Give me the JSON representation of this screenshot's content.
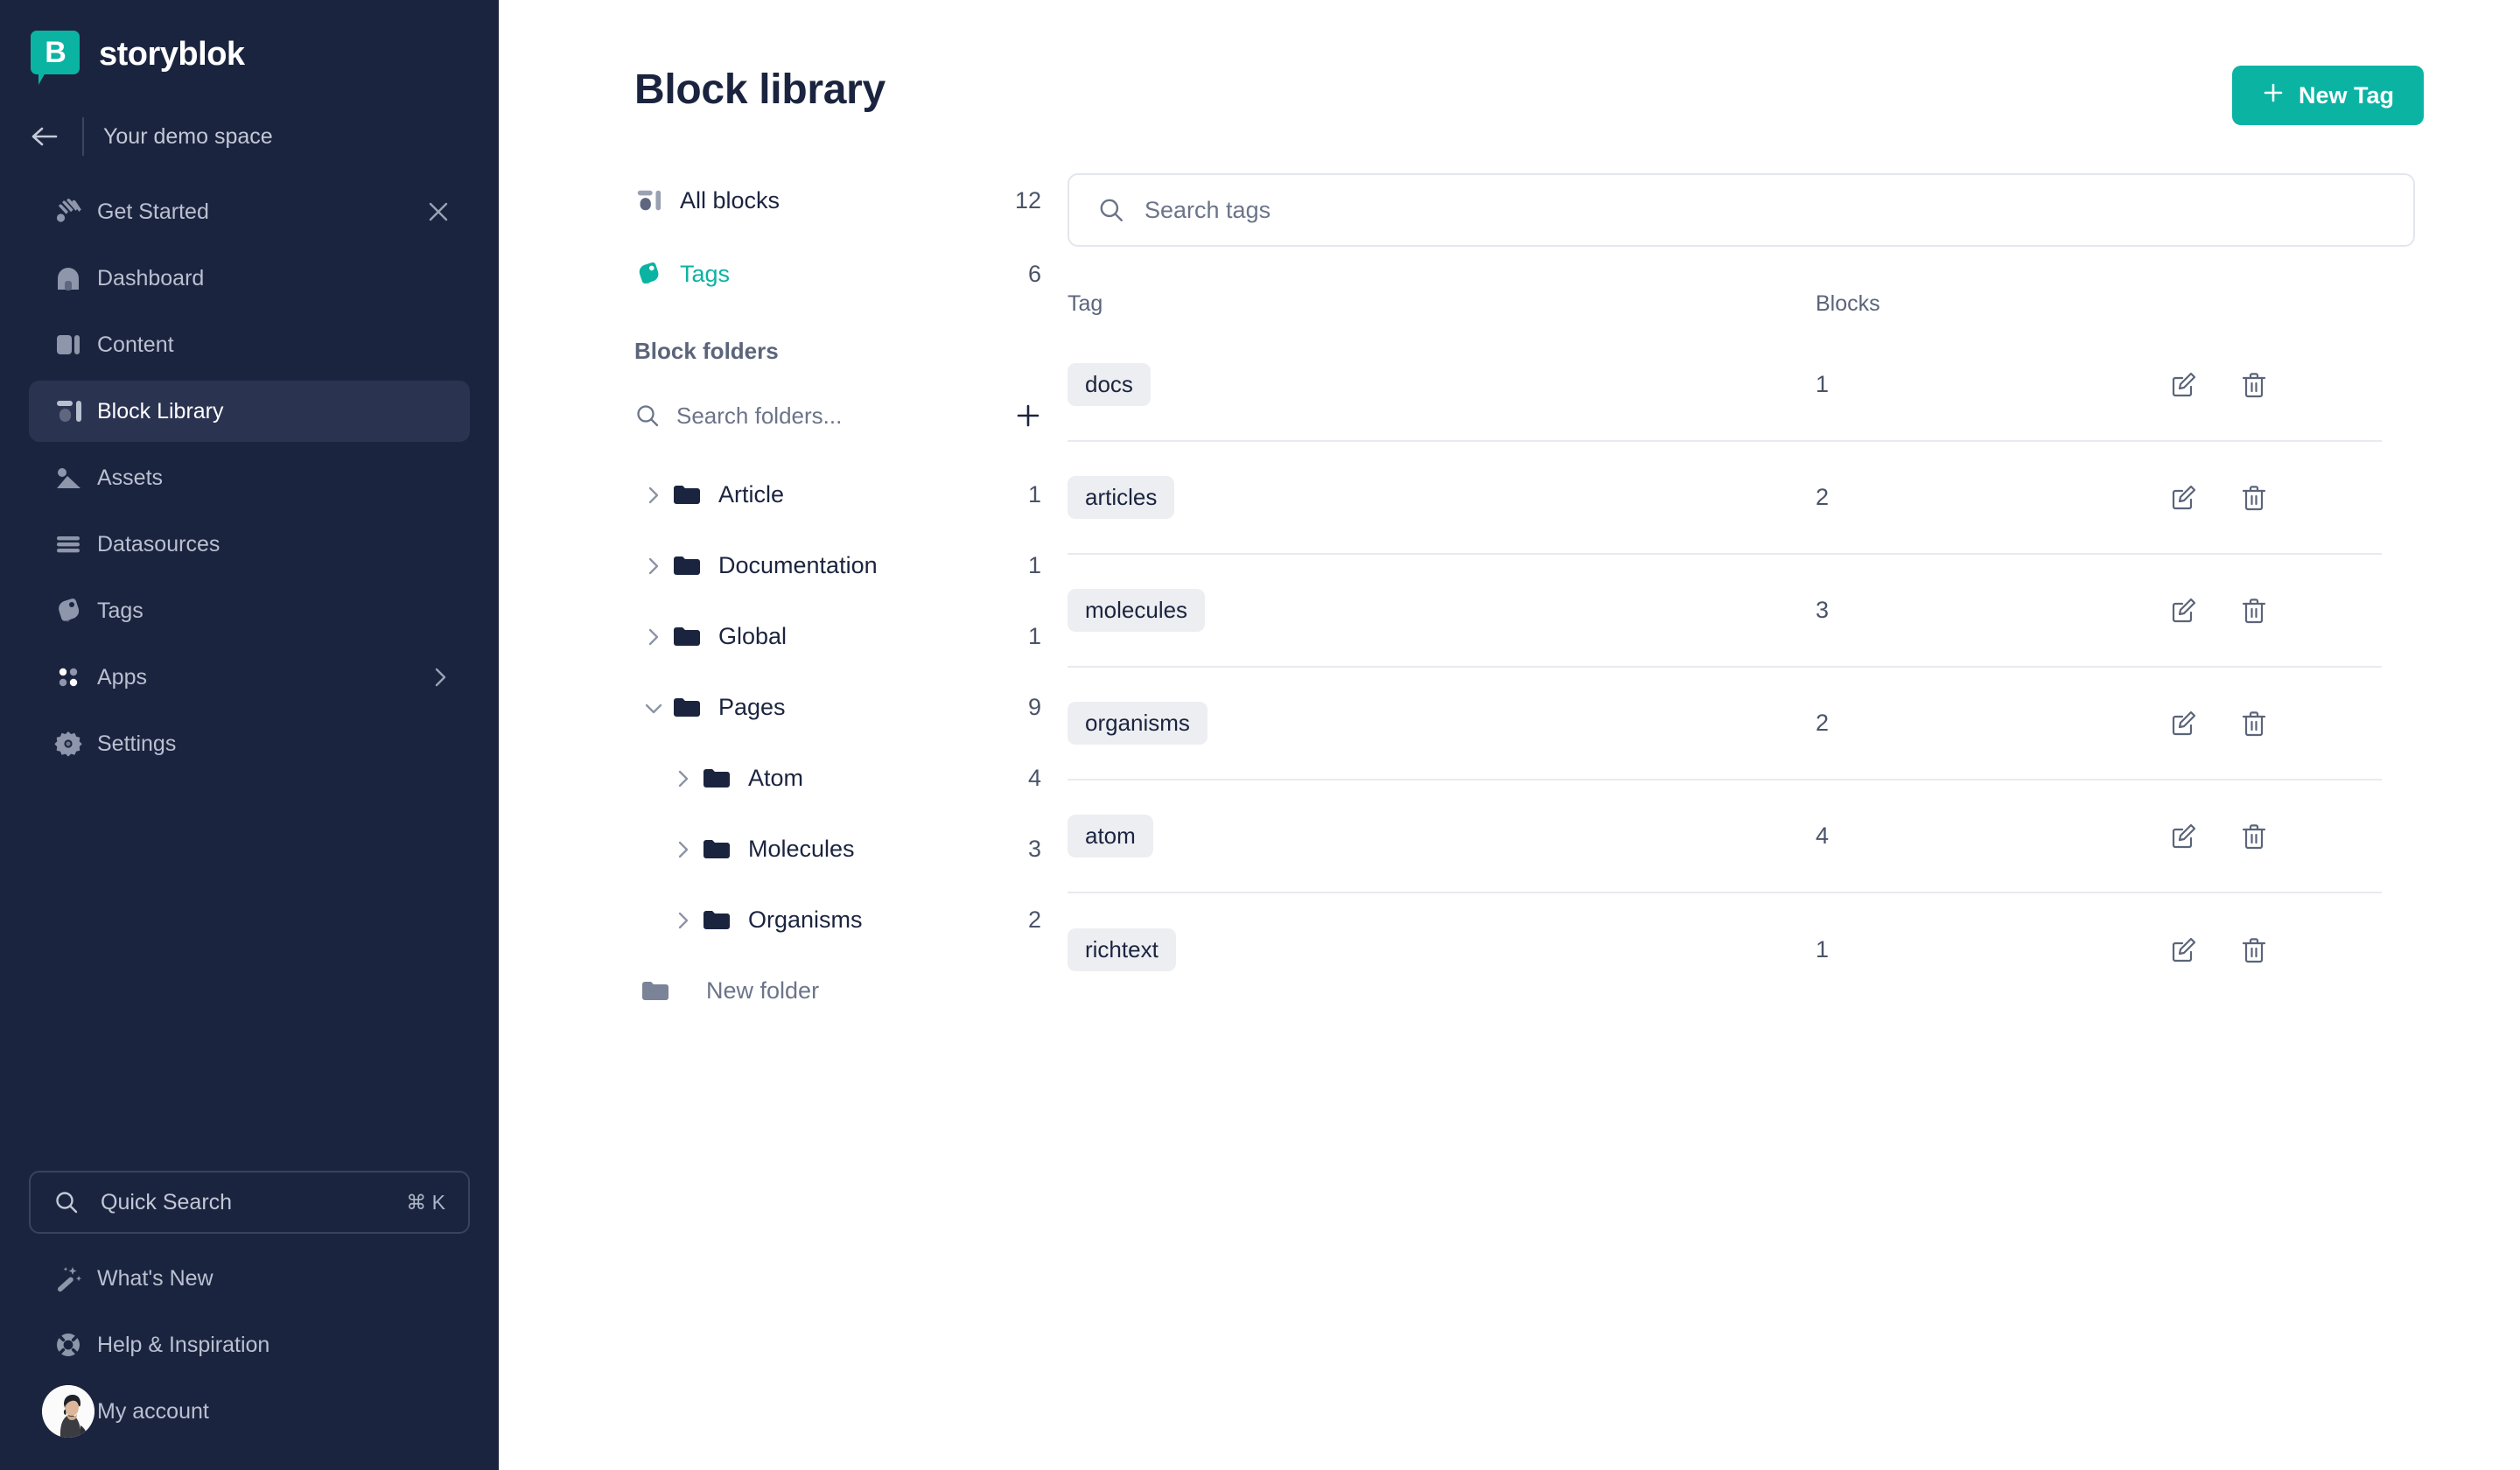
{
  "brand": {
    "name": "storyblok",
    "logo_letter": "B",
    "accent_color": "#0bb3a3",
    "sidebar_color": "#1b243f"
  },
  "sidebar": {
    "space": {
      "label": "Your demo space",
      "back_icon": "arrow-left-icon"
    },
    "items": [
      {
        "label": "Get Started",
        "icon": "waving-hand-icon",
        "trailing": "close-icon",
        "active": false
      },
      {
        "label": "Dashboard",
        "icon": "dashboard-icon",
        "trailing": "",
        "active": false
      },
      {
        "label": "Content",
        "icon": "content-icon",
        "trailing": "",
        "active": false
      },
      {
        "label": "Block Library",
        "icon": "blocks-icon",
        "trailing": "",
        "active": true
      },
      {
        "label": "Assets",
        "icon": "image-icon",
        "trailing": "",
        "active": false
      },
      {
        "label": "Datasources",
        "icon": "lines-icon",
        "trailing": "",
        "active": false
      },
      {
        "label": "Tags",
        "icon": "tag-icon",
        "trailing": "",
        "active": false
      },
      {
        "label": "Apps",
        "icon": "apps-grid-icon",
        "trailing": "chevron-right-icon",
        "active": false
      },
      {
        "label": "Settings",
        "icon": "gear-icon",
        "trailing": "",
        "active": false
      }
    ],
    "quick_search": {
      "label": "Quick Search",
      "shortcut": "⌘ K",
      "icon": "search-icon"
    },
    "bottom_items": [
      {
        "label": "What's New",
        "icon": "magic-wand-icon"
      },
      {
        "label": "Help & Inspiration",
        "icon": "lifebuoy-icon"
      }
    ],
    "account": {
      "label": "My account",
      "icon": "avatar"
    }
  },
  "header": {
    "title": "Block library",
    "new_tag_button": {
      "label": "New Tag",
      "icon": "plus-icon"
    }
  },
  "folders_panel": {
    "all_blocks": {
      "label": "All blocks",
      "count": "12",
      "icon": "blocks-icon"
    },
    "tags": {
      "label": "Tags",
      "count": "6",
      "icon": "tag-icon"
    },
    "section_title": "Block folders",
    "search": {
      "placeholder": "Search folders...",
      "icon": "search-icon",
      "add_icon": "plus-icon"
    },
    "tree": [
      {
        "label": "Article",
        "count": "1",
        "depth": 0,
        "expanded": false
      },
      {
        "label": "Documentation",
        "count": "1",
        "depth": 0,
        "expanded": false
      },
      {
        "label": "Global",
        "count": "1",
        "depth": 0,
        "expanded": false
      },
      {
        "label": "Pages",
        "count": "9",
        "depth": 0,
        "expanded": true
      },
      {
        "label": "Atom",
        "count": "4",
        "depth": 1,
        "expanded": false
      },
      {
        "label": "Molecules",
        "count": "3",
        "depth": 1,
        "expanded": false
      },
      {
        "label": "Organisms",
        "count": "2",
        "depth": 1,
        "expanded": false
      }
    ],
    "new_folder": {
      "label": "New folder",
      "icon": "folder-icon"
    }
  },
  "tags_panel": {
    "search": {
      "placeholder": "Search tags",
      "value": "",
      "icon": "search-icon"
    },
    "columns": {
      "tag": "Tag",
      "blocks": "Blocks"
    },
    "rows": [
      {
        "tag": "docs",
        "blocks": "1",
        "edit_icon": "edit-icon",
        "delete_icon": "trash-icon"
      },
      {
        "tag": "articles",
        "blocks": "2",
        "edit_icon": "edit-icon",
        "delete_icon": "trash-icon"
      },
      {
        "tag": "molecules",
        "blocks": "3",
        "edit_icon": "edit-icon",
        "delete_icon": "trash-icon"
      },
      {
        "tag": "organisms",
        "blocks": "2",
        "edit_icon": "edit-icon",
        "delete_icon": "trash-icon"
      },
      {
        "tag": "atom",
        "blocks": "4",
        "edit_icon": "edit-icon",
        "delete_icon": "trash-icon"
      },
      {
        "tag": "richtext",
        "blocks": "1",
        "edit_icon": "edit-icon",
        "delete_icon": "trash-icon"
      }
    ]
  }
}
